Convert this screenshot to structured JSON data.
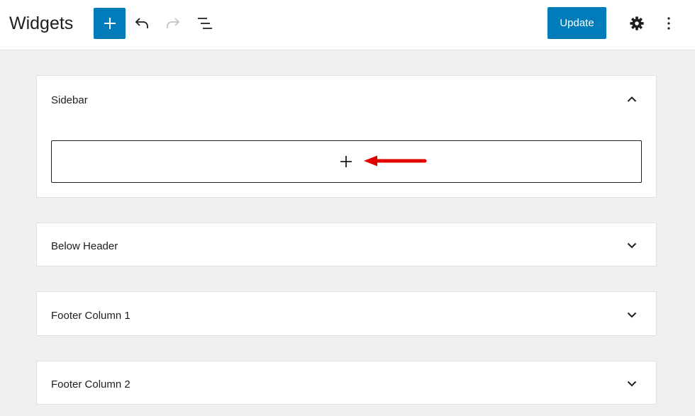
{
  "header": {
    "title": "Widgets",
    "update_label": "Update",
    "accent_color": "#007cba",
    "icons": {
      "add": "plus-icon",
      "undo": "undo-icon",
      "redo": "redo-icon",
      "list_view": "list-view-icon",
      "settings": "gear-icon",
      "options": "more-vertical-icon"
    }
  },
  "widget_areas": [
    {
      "label": "Sidebar",
      "expanded": true,
      "toggle_icon": "chevron-up-icon"
    },
    {
      "label": "Below Header",
      "expanded": false,
      "toggle_icon": "chevron-down-icon"
    },
    {
      "label": "Footer Column 1",
      "expanded": false,
      "toggle_icon": "chevron-down-icon"
    },
    {
      "label": "Footer Column 2",
      "expanded": false,
      "toggle_icon": "chevron-down-icon"
    }
  ],
  "annotation": {
    "icon": "red-arrow-icon",
    "color": "#e00000"
  }
}
